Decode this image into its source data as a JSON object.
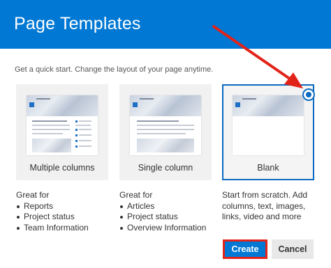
{
  "header": {
    "title": "Page Templates"
  },
  "subtitle": "Get a quick start. Change the layout of your page anytime.",
  "templates": [
    {
      "label": "Multiple columns",
      "description_title": "Great for",
      "bullets": [
        "Reports",
        "Project status",
        "Team Information"
      ]
    },
    {
      "label": "Single column",
      "description_title": "Great for",
      "bullets": [
        "Articles",
        "Project status",
        "Overview Information"
      ]
    },
    {
      "label": "Blank",
      "selected": true,
      "description": "Start from scratch. Add columns, text, images, links, video and more"
    }
  ],
  "buttons": {
    "create": "Create",
    "cancel": "Cancel"
  },
  "colors": {
    "header_bg": "#0078d4",
    "selection": "#0a6ac2",
    "annotation_red": "#e2231a"
  }
}
